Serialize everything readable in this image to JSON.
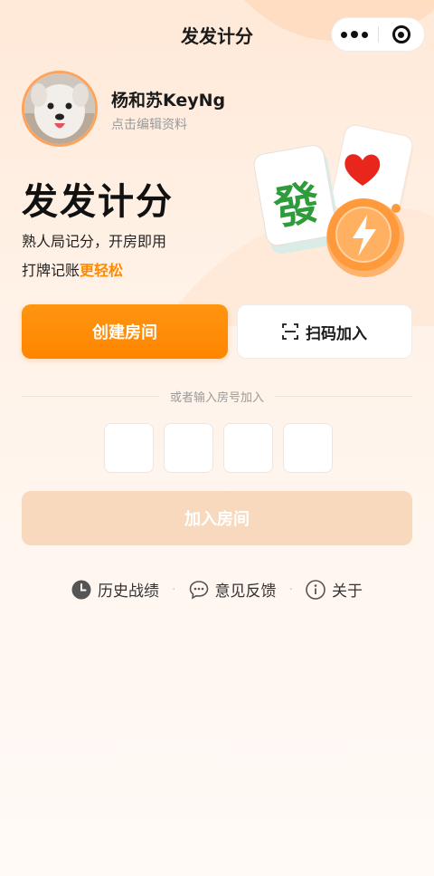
{
  "nav": {
    "title": "发发计分",
    "more_icon": "more-dots-icon",
    "close_icon": "miniprogram-close-icon"
  },
  "profile": {
    "name": "杨和苏KeyNg",
    "subtitle": "点击编辑资料"
  },
  "hero": {
    "title": "发发计分",
    "line1": "熟人局记分，开房即用",
    "line2_prefix": "打牌记账",
    "line2_highlight": "更轻松",
    "tile_glyph": "發"
  },
  "actions": {
    "create_room": "创建房间",
    "scan_join": "扫码加入",
    "divider_text": "或者输入房号加入",
    "join_room": "加入房间"
  },
  "code_inputs": [
    "",
    "",
    "",
    ""
  ],
  "footer": {
    "history": "历史战绩",
    "feedback": "意见反馈",
    "about": "关于",
    "separator": "·"
  },
  "colors": {
    "accent": "#ff8a00",
    "join_disabled": "#f9d9bd",
    "tile_green": "#2e9c3a",
    "heart_red": "#e8261c"
  }
}
